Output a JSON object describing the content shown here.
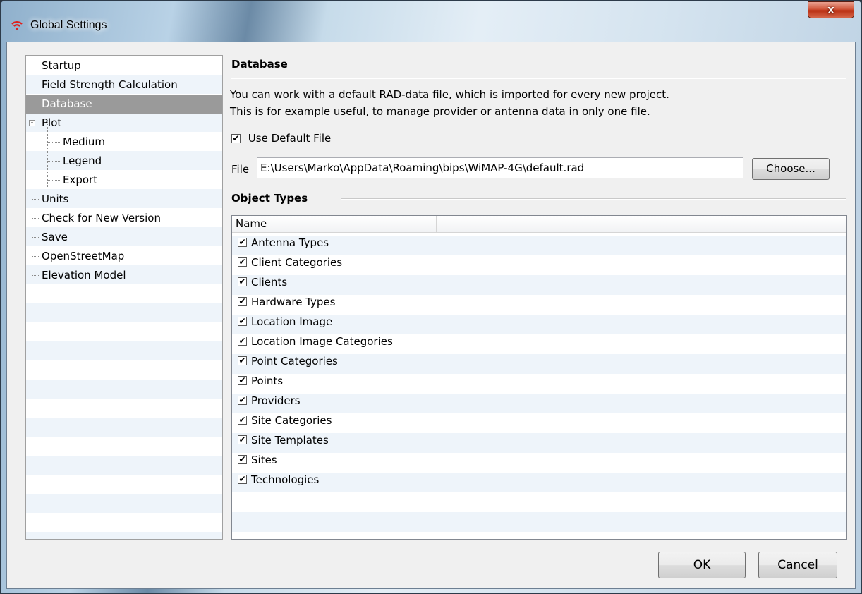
{
  "window": {
    "title": "Global Settings",
    "close_label": "x"
  },
  "tree": {
    "items": [
      {
        "label": "Startup"
      },
      {
        "label": "Field Strength Calculation"
      },
      {
        "label": "Database",
        "selected": true
      },
      {
        "label": "Plot",
        "expander": "-"
      },
      {
        "label": "Medium"
      },
      {
        "label": "Legend"
      },
      {
        "label": "Export"
      },
      {
        "label": "Units"
      },
      {
        "label": "Check for New Version"
      },
      {
        "label": "Save"
      },
      {
        "label": "OpenStreetMap"
      },
      {
        "label": "Elevation Model"
      }
    ]
  },
  "database": {
    "heading": "Database",
    "description_line1": "You can work with a default RAD-data file, which is imported for every new project.",
    "description_line2": "This is for example useful, to manage provider or antenna data in only one file.",
    "use_default_label": "Use Default File",
    "use_default_checked": true,
    "file_label": "File",
    "file_value": "E:\\Users\\Marko\\AppData\\Roaming\\bips\\WiMAP-4G\\default.rad",
    "choose_label": "Choose..."
  },
  "object_types": {
    "heading": "Object Types",
    "column_name": "Name",
    "check_mark": "✔",
    "items": [
      "Antenna Types",
      "Client Categories",
      "Clients",
      "Hardware Types",
      "Location Image",
      "Location Image Categories",
      "Point Categories",
      "Points",
      "Providers",
      "Site Categories",
      "Site Templates",
      "Sites",
      "Technologies"
    ]
  },
  "buttons": {
    "ok": "OK",
    "cancel": "Cancel"
  },
  "colors": {
    "selection": "#9a9a9a",
    "close_button": "#c7432a",
    "wifi_icon": "#e0201b"
  }
}
